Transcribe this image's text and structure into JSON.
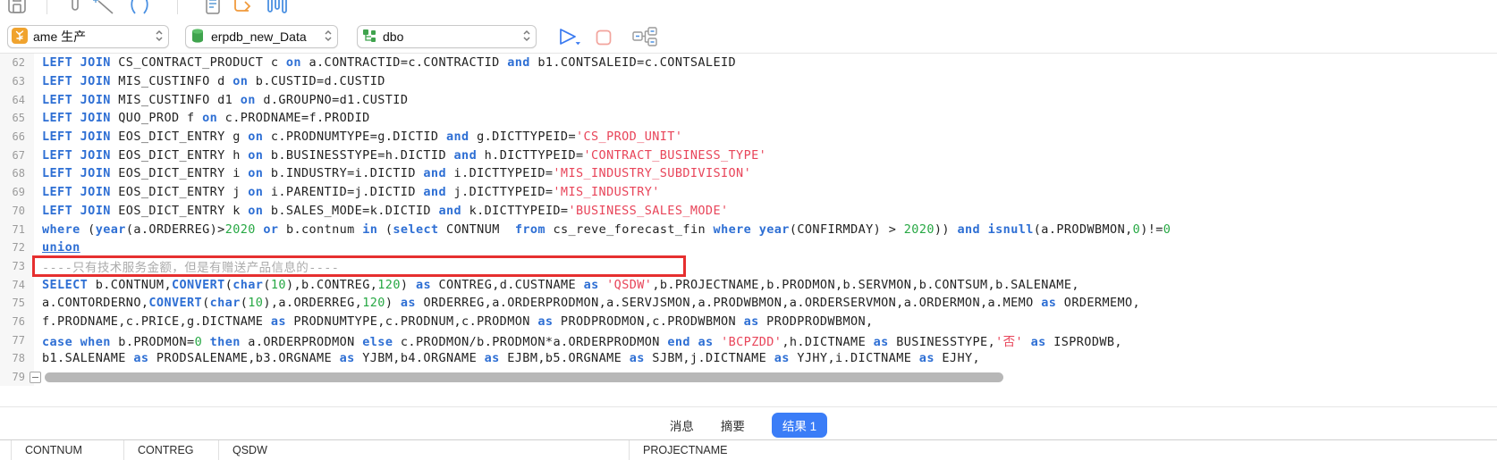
{
  "toolbar": {
    "icons": [
      "save-icon",
      "pin-icon",
      "magic-wand-icon",
      "format-parentheses-icon",
      "document-icon",
      "redo-arrow-icon",
      "histogram-icon"
    ],
    "connection_select": {
      "icon": "connection-icon",
      "value": "ame 生产"
    },
    "database_select": {
      "icon": "database-icon",
      "value": "erpdb_new_Data"
    },
    "schema_select": {
      "icon": "schema-icon",
      "value": "dbo"
    },
    "run_button": "run-query",
    "stop_button": "stop-query",
    "plan_button": "explain-plan"
  },
  "colors": {
    "accent_blue": "#3b7df7",
    "keyword": "#2e6fd4",
    "string": "#e8455a",
    "number": "#27a844",
    "comment": "#ababab",
    "annotation_red": "#e62f2f"
  },
  "editor": {
    "lines": [
      {
        "num": 62,
        "tokens": [
          [
            "k",
            "LEFT JOIN"
          ],
          [
            "",
            " CS_CONTRACT_PRODUCT c "
          ],
          [
            "k",
            "on"
          ],
          [
            "",
            " a.CONTRACTID=c.CONTRACTID "
          ],
          [
            "k",
            "and"
          ],
          [
            "",
            " b1.CONTSALEID=c.CONTSALEID"
          ]
        ]
      },
      {
        "num": 63,
        "tokens": [
          [
            "k",
            "LEFT JOIN"
          ],
          [
            "",
            " MIS_CUSTINFO d "
          ],
          [
            "k",
            "on"
          ],
          [
            "",
            " b.CUSTID=d.CUSTID"
          ]
        ]
      },
      {
        "num": 64,
        "tokens": [
          [
            "k",
            "LEFT JOIN"
          ],
          [
            "",
            " MIS_CUSTINFO d1 "
          ],
          [
            "k",
            "on"
          ],
          [
            "",
            " d.GROUPNO=d1.CUSTID"
          ]
        ]
      },
      {
        "num": 65,
        "tokens": [
          [
            "k",
            "LEFT JOIN"
          ],
          [
            "",
            " QUO_PROD f "
          ],
          [
            "k",
            "on"
          ],
          [
            "",
            " c.PRODNAME=f.PRODID"
          ]
        ]
      },
      {
        "num": 66,
        "tokens": [
          [
            "k",
            "LEFT JOIN"
          ],
          [
            "",
            " EOS_DICT_ENTRY g "
          ],
          [
            "k",
            "on"
          ],
          [
            "",
            " c.PRODNUMTYPE=g.DICTID "
          ],
          [
            "k",
            "and"
          ],
          [
            "",
            " g.DICTTYPEID="
          ],
          [
            "s",
            "'CS_PROD_UNIT'"
          ]
        ]
      },
      {
        "num": 67,
        "tokens": [
          [
            "k",
            "LEFT JOIN"
          ],
          [
            "",
            " EOS_DICT_ENTRY h "
          ],
          [
            "k",
            "on"
          ],
          [
            "",
            " b.BUSINESSTYPE=h.DICTID "
          ],
          [
            "k",
            "and"
          ],
          [
            "",
            " h.DICTTYPEID="
          ],
          [
            "s",
            "'CONTRACT_BUSINESS_TYPE'"
          ]
        ]
      },
      {
        "num": 68,
        "tokens": [
          [
            "k",
            "LEFT JOIN"
          ],
          [
            "",
            " EOS_DICT_ENTRY i "
          ],
          [
            "k",
            "on"
          ],
          [
            "",
            " b.INDUSTRY=i.DICTID "
          ],
          [
            "k",
            "and"
          ],
          [
            "",
            " i.DICTTYPEID="
          ],
          [
            "s",
            "'MIS_INDUSTRY_SUBDIVISION'"
          ]
        ]
      },
      {
        "num": 69,
        "tokens": [
          [
            "k",
            "LEFT JOIN"
          ],
          [
            "",
            " EOS_DICT_ENTRY j "
          ],
          [
            "k",
            "on"
          ],
          [
            "",
            " i.PARENTID=j.DICTID "
          ],
          [
            "k",
            "and"
          ],
          [
            "",
            " j.DICTTYPEID="
          ],
          [
            "s",
            "'MIS_INDUSTRY'"
          ]
        ]
      },
      {
        "num": 70,
        "tokens": [
          [
            "k",
            "LEFT JOIN"
          ],
          [
            "",
            " EOS_DICT_ENTRY k "
          ],
          [
            "k",
            "on"
          ],
          [
            "",
            " b.SALES_MODE=k.DICTID "
          ],
          [
            "k",
            "and"
          ],
          [
            "",
            " k.DICTTYPEID="
          ],
          [
            "s",
            "'BUSINESS_SALES_MODE'"
          ]
        ]
      },
      {
        "num": 71,
        "tokens": [
          [
            "k",
            "where"
          ],
          [
            "",
            " ("
          ],
          [
            "k",
            "year"
          ],
          [
            "",
            "(a.ORDERREG)>"
          ],
          [
            "n",
            "2020"
          ],
          [
            "",
            " "
          ],
          [
            "k",
            "or"
          ],
          [
            "",
            " b.contnum "
          ],
          [
            "k",
            "in"
          ],
          [
            "",
            " ("
          ],
          [
            "k",
            "select"
          ],
          [
            "",
            " CONTNUM  "
          ],
          [
            "k",
            "from"
          ],
          [
            "",
            " cs_reve_forecast_fin "
          ],
          [
            "k",
            "where"
          ],
          [
            "",
            " "
          ],
          [
            "k",
            "year"
          ],
          [
            "",
            "(CONFIRMDAY) > "
          ],
          [
            "n",
            "2020"
          ],
          [
            "",
            ")) "
          ],
          [
            "k",
            "and"
          ],
          [
            "",
            " "
          ],
          [
            "k",
            "isnull"
          ],
          [
            "",
            "(a.PRODWBMON,"
          ],
          [
            "n",
            "0"
          ],
          [
            "",
            ")!="
          ],
          [
            "n",
            "0"
          ]
        ]
      },
      {
        "num": 72,
        "tokens": [
          [
            "ku",
            "union"
          ]
        ]
      },
      {
        "num": 73,
        "tokens": [
          [
            "c",
            "----只有技术服务金额，但是有赠送产品信息的----"
          ]
        ]
      },
      {
        "num": 74,
        "tokens": [
          [
            "k",
            "SELECT"
          ],
          [
            "",
            " b.CONTNUM,"
          ],
          [
            "k",
            "CONVERT"
          ],
          [
            "",
            "("
          ],
          [
            "k",
            "char"
          ],
          [
            "",
            "("
          ],
          [
            "n",
            "10"
          ],
          [
            "",
            "),b.CONTREG,"
          ],
          [
            "n",
            "120"
          ],
          [
            "",
            ") "
          ],
          [
            "k",
            "as"
          ],
          [
            "",
            " CONTREG,d.CUSTNAME "
          ],
          [
            "k",
            "as"
          ],
          [
            "",
            " "
          ],
          [
            "s",
            "'QSDW'"
          ],
          [
            "",
            ",b.PROJECTNAME,b.PRODMON,b.SERVMON,b.CONTSUM,b.SALENAME,"
          ]
        ]
      },
      {
        "num": 75,
        "tokens": [
          [
            "",
            "a.CONTORDERNO,"
          ],
          [
            "k",
            "CONVERT"
          ],
          [
            "",
            "("
          ],
          [
            "k",
            "char"
          ],
          [
            "",
            "("
          ],
          [
            "n",
            "10"
          ],
          [
            "",
            "),a.ORDERREG,"
          ],
          [
            "n",
            "120"
          ],
          [
            "",
            ") "
          ],
          [
            "k",
            "as"
          ],
          [
            "",
            " ORDERREG,a.ORDERPRODMON,a.SERVJSMON,a.PRODWBMON,a.ORDERSERVMON,a.ORDERMON,a.MEMO "
          ],
          [
            "k",
            "as"
          ],
          [
            "",
            " ORDERMEMO,"
          ]
        ]
      },
      {
        "num": 76,
        "tokens": [
          [
            "",
            "f.PRODNAME,c.PRICE,g.DICTNAME "
          ],
          [
            "k",
            "as"
          ],
          [
            "",
            " PRODNUMTYPE,c.PRODNUM,c.PRODMON "
          ],
          [
            "k",
            "as"
          ],
          [
            "",
            " PRODPRODMON,c.PRODWBMON "
          ],
          [
            "k",
            "as"
          ],
          [
            "",
            " PRODPRODWBMON,"
          ]
        ]
      },
      {
        "num": 77,
        "tokens": [
          [
            "k",
            "case"
          ],
          [
            "",
            " "
          ],
          [
            "k",
            "when"
          ],
          [
            "",
            " b.PRODMON="
          ],
          [
            "n",
            "0"
          ],
          [
            "",
            " "
          ],
          [
            "k",
            "then"
          ],
          [
            "",
            " a.ORDERPRODMON "
          ],
          [
            "k",
            "else"
          ],
          [
            "",
            " c.PRODMON/b.PRODMON*a.ORDERPRODMON "
          ],
          [
            "k",
            "end"
          ],
          [
            "",
            " "
          ],
          [
            "k",
            "as"
          ],
          [
            "",
            " "
          ],
          [
            "s",
            "'BCPZDD'"
          ],
          [
            "",
            ",h.DICTNAME "
          ],
          [
            "k",
            "as"
          ],
          [
            "",
            " BUSINESSTYPE,"
          ],
          [
            "s",
            "'否'"
          ],
          [
            "",
            " "
          ],
          [
            "k",
            "as"
          ],
          [
            "",
            " ISPRODWB,"
          ]
        ]
      },
      {
        "num": 78,
        "tokens": [
          [
            "",
            "b1.SALENAME "
          ],
          [
            "k",
            "as"
          ],
          [
            "",
            " PRODSALENAME,b3.ORGNAME "
          ],
          [
            "k",
            "as"
          ],
          [
            "",
            " YJBM,b4.ORGNAME "
          ],
          [
            "k",
            "as"
          ],
          [
            "",
            " EJBM,b5.ORGNAME "
          ],
          [
            "k",
            "as"
          ],
          [
            "",
            " SJBM,j.DICTNAME "
          ],
          [
            "k",
            "as"
          ],
          [
            "",
            " YJHY,i.DICTNAME "
          ],
          [
            "k",
            "as"
          ],
          [
            "",
            " EJHY,"
          ]
        ]
      },
      {
        "num": 79,
        "tokens": [],
        "fold": true,
        "scrollbar": true
      }
    ],
    "annotation_note": "red box drawn around line 73 comment"
  },
  "results": {
    "tabs": [
      {
        "label": "消息",
        "active": false
      },
      {
        "label": "摘要",
        "active": false
      },
      {
        "label": "结果 1",
        "active": true
      }
    ]
  },
  "results_table": {
    "columns": [
      "CONTNUM",
      "CONTREG",
      "QSDW",
      "PROJECTNAME"
    ]
  }
}
